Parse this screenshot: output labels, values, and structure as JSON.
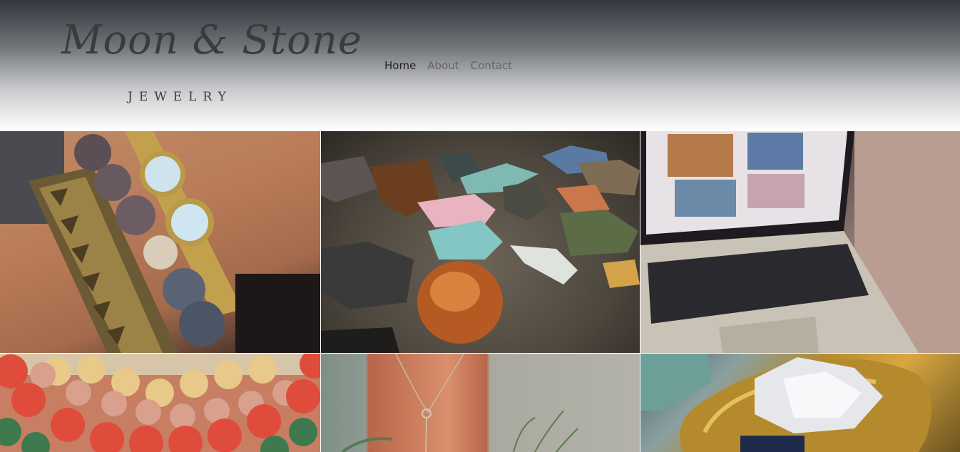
{
  "brand": {
    "script": "Moon & Stone",
    "sub": "JEWELRY"
  },
  "nav": {
    "items": [
      {
        "label": "Home",
        "active": true
      },
      {
        "label": "About",
        "active": false
      },
      {
        "label": "Contact",
        "active": false
      }
    ]
  },
  "gallery": {
    "tiles": [
      {
        "subject": "bracelets-photo"
      },
      {
        "subject": "stones-photo"
      },
      {
        "subject": "laptop-photo"
      },
      {
        "subject": "beads-photo"
      },
      {
        "subject": "necklace-photo"
      },
      {
        "subject": "crystal-photo"
      }
    ]
  },
  "colors": {
    "header_top": "#33373e",
    "header_bottom": "#ffffff",
    "nav_active": "#222222",
    "nav_inactive": "#666666",
    "logo": "#3a3b3d"
  }
}
